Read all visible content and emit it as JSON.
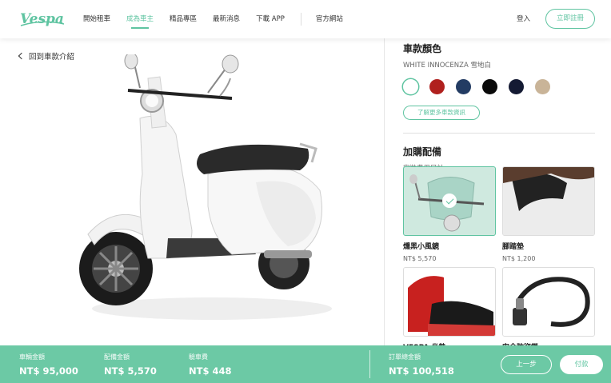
{
  "nav": {
    "logo_text": "Vespa",
    "links": [
      {
        "label": "開始租車"
      },
      {
        "label": "成為車主"
      },
      {
        "label": "精品專區"
      },
      {
        "label": "最新消息"
      },
      {
        "label": "下載 APP"
      }
    ],
    "external_link": "官方網站",
    "login": "登入",
    "register": "立即註冊"
  },
  "back_link": "回到車款介紹",
  "color_section": {
    "title": "車款顏色",
    "selected_name": "WHITE INNOCENZA 雪地白",
    "swatches": [
      "#ffffff",
      "#b0201e",
      "#233c63",
      "#0a0a0a",
      "#141a33",
      "#c9b498"
    ],
    "more_info": "了解更多車款資訊"
  },
  "accessory_section": {
    "title": "加購配備",
    "subtitle": "安裝費用另計",
    "items": [
      {
        "name": "燻黑小風鏡",
        "price": "NT$ 5,570",
        "selected": true,
        "icon": "windscreen-image"
      },
      {
        "name": "腳踏墊",
        "price": "NT$ 1,200",
        "selected": false,
        "icon": "footmat-image"
      },
      {
        "name": "VESPA 坐墊",
        "price": "",
        "selected": false,
        "icon": "topcase-image"
      },
      {
        "name": "安全防盜鎖",
        "price": "",
        "selected": false,
        "icon": "chain-lock-image"
      }
    ]
  },
  "summary": {
    "vehicle_label": "車輛金額",
    "vehicle_value": "NT$ 95,000",
    "accessory_label": "配備金額",
    "accessory_value": "NT$ 5,570",
    "license_label": "驗車費",
    "license_value": "NT$ 448",
    "total_label": "訂單總金額",
    "total_value": "NT$ 100,518",
    "prev": "上一步",
    "pay": "付款"
  },
  "colors": {
    "accent": "#5fc4a1",
    "bar": "#6cc9a5"
  }
}
